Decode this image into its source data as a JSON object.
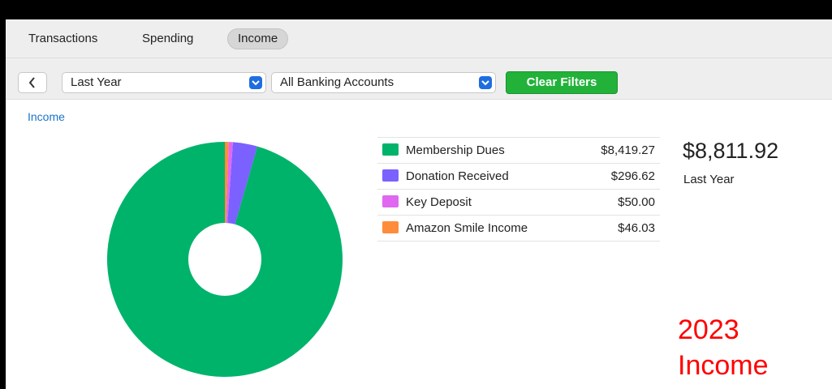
{
  "tabs": [
    {
      "label": "Transactions",
      "active": false
    },
    {
      "label": "Spending",
      "active": false
    },
    {
      "label": "Income",
      "active": true
    }
  ],
  "filters": {
    "back_icon": "chevron-left-icon",
    "period": {
      "value": "Last Year",
      "icon": "chevron-down-icon"
    },
    "account": {
      "value": "All Banking Accounts",
      "icon": "chevron-down-icon"
    },
    "clear_label": "Clear Filters"
  },
  "section": {
    "title": "Income"
  },
  "summary": {
    "total": "$8,811.92",
    "period": "Last Year"
  },
  "annotation": {
    "line1": "2023",
    "line2": "Income"
  },
  "legend": [
    {
      "name": "Membership Dues",
      "amount": "$8,419.27",
      "color": "#00b36b"
    },
    {
      "name": "Donation Received",
      "amount": "$296.62",
      "color": "#7b61ff"
    },
    {
      "name": "Key Deposit",
      "amount": "$50.00",
      "color": "#e067f0"
    },
    {
      "name": "Amazon Smile Income",
      "amount": "$46.03",
      "color": "#ff8c3a"
    }
  ],
  "colors": {
    "accent": "#22b23a",
    "link": "#1a73c9",
    "annotation": "#ff0000"
  },
  "chart_data": {
    "type": "pie",
    "labels": [
      "Membership Dues",
      "Donation Received",
      "Key Deposit",
      "Amazon Smile Income"
    ],
    "values": [
      8419.27,
      296.62,
      50.0,
      46.03
    ],
    "colors": [
      "#00b36b",
      "#7b61ff",
      "#e067f0",
      "#ff8c3a"
    ],
    "donut": true,
    "legend": "right"
  }
}
